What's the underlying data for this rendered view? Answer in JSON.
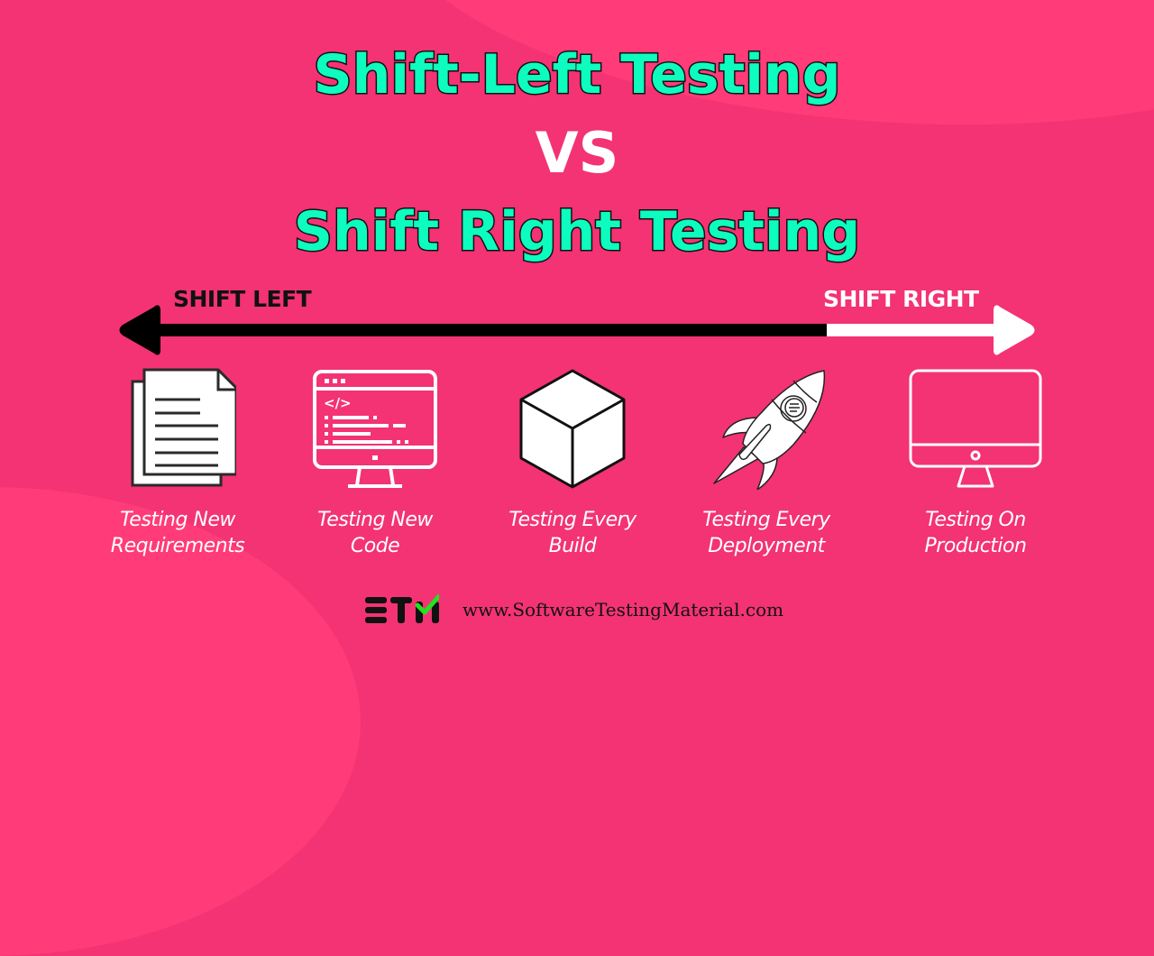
{
  "title": {
    "line1": "Shift-Left Testing",
    "vs": "VS",
    "line2": "Shift Right Testing"
  },
  "axis": {
    "left_label": "SHIFT LEFT",
    "right_label": "SHIFT RIGHT"
  },
  "stages": [
    {
      "icon": "documents-icon",
      "line1": "Testing New",
      "line2": "Requirements"
    },
    {
      "icon": "code-monitor-icon",
      "line1": "Testing New",
      "line2": "Code"
    },
    {
      "icon": "cube-icon",
      "line1": "Testing Every",
      "line2": "Build"
    },
    {
      "icon": "rocket-icon",
      "line1": "Testing Every",
      "line2": "Deployment"
    },
    {
      "icon": "monitor-icon",
      "line1": "Testing On",
      "line2": "Production"
    }
  ],
  "footer": {
    "logo_text": "STM",
    "url": "www.SoftwareTestingMaterial.com"
  },
  "colors": {
    "background": "#f33373",
    "title_fill": "#0dfdbf",
    "logo_check": "#22e222"
  }
}
